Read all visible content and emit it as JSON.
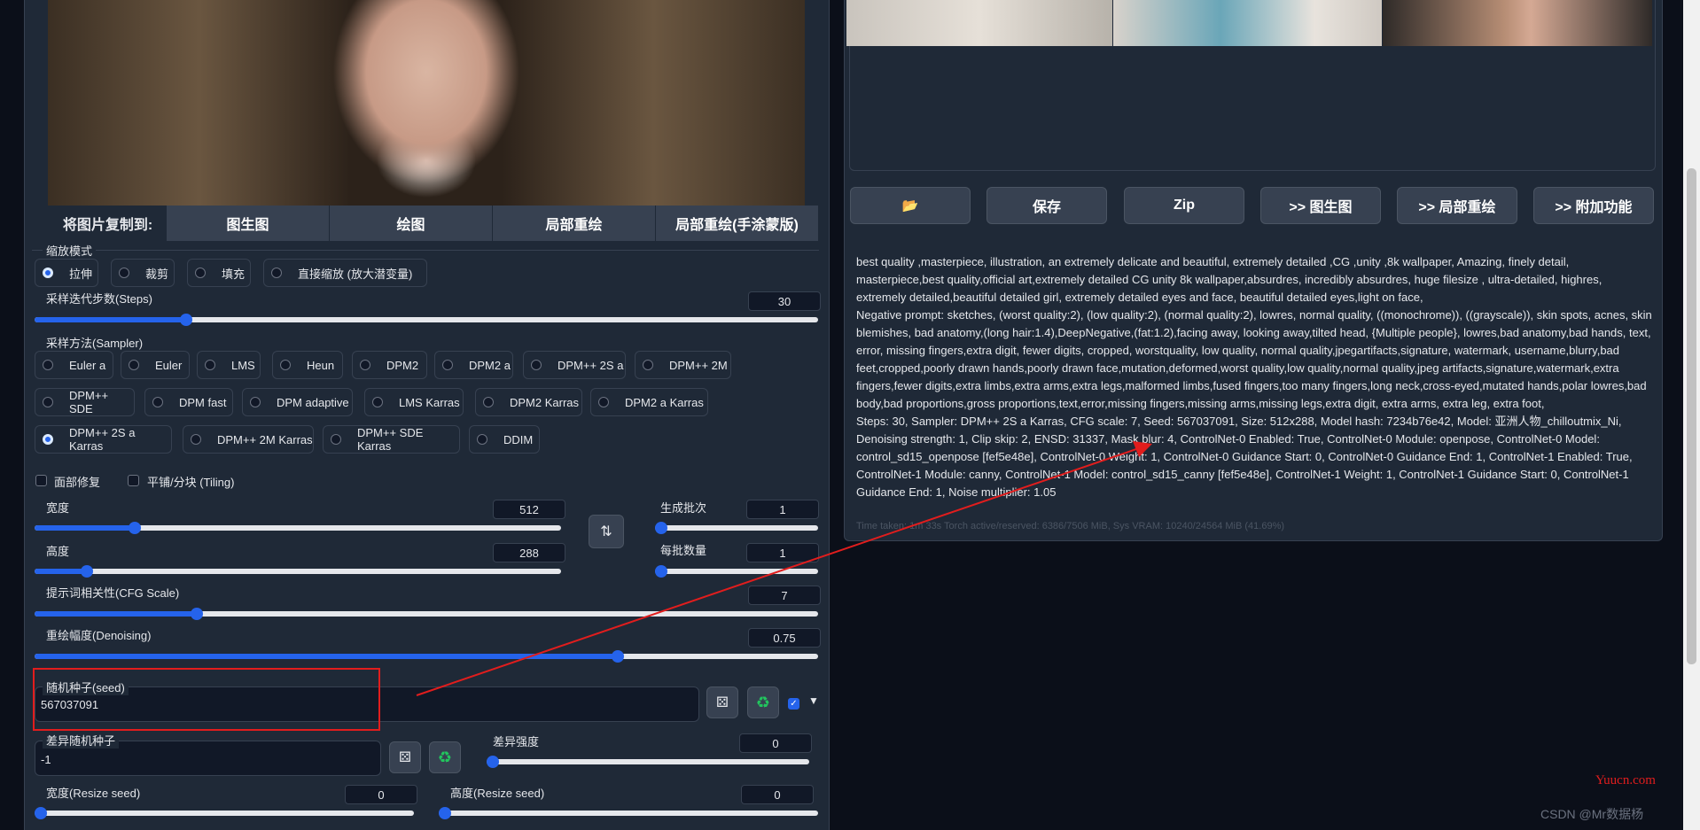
{
  "copy_to": {
    "label": "将图片复制到:",
    "buttons": [
      "图生图",
      "绘图",
      "局部重绘",
      "局部重绘(手涂蒙版)"
    ]
  },
  "resize_mode": {
    "label": "缩放模式",
    "options": [
      "拉伸",
      "裁剪",
      "填充",
      "直接缩放 (放大潜变量)"
    ],
    "selected": "拉伸"
  },
  "steps": {
    "label": "采样迭代步数(Steps)",
    "value": "30"
  },
  "sampler": {
    "label": "采样方法(Sampler)",
    "options": [
      "Euler a",
      "Euler",
      "LMS",
      "Heun",
      "DPM2",
      "DPM2 a",
      "DPM++ 2S a",
      "DPM++ 2M",
      "DPM++ SDE",
      "DPM fast",
      "DPM adaptive",
      "LMS Karras",
      "DPM2 Karras",
      "DPM2 a Karras",
      "DPM++ 2S a Karras",
      "DPM++ 2M Karras",
      "DPM++ SDE Karras",
      "DDIM"
    ],
    "selected": "DPM++ 2S a Karras"
  },
  "checkboxes": {
    "face_restore": "面部修复",
    "tiling": "平铺/分块 (Tiling)"
  },
  "width": {
    "label": "宽度",
    "value": "512"
  },
  "height": {
    "label": "高度",
    "value": "288"
  },
  "batch_count": {
    "label": "生成批次",
    "value": "1"
  },
  "batch_size": {
    "label": "每批数量",
    "value": "1"
  },
  "cfg": {
    "label": "提示词相关性(CFG Scale)",
    "value": "7"
  },
  "denoising": {
    "label": "重绘幅度(Denoising)",
    "value": "0.75"
  },
  "seed": {
    "label": "随机种子(seed)",
    "value": "567037091"
  },
  "variation_seed": {
    "label": "差异随机种子",
    "value": "-1"
  },
  "variation_strength": {
    "label": "差异强度",
    "value": "0"
  },
  "resize_seed_width": {
    "label": "宽度(Resize seed)",
    "value": "0"
  },
  "resize_seed_height": {
    "label": "高度(Resize seed)",
    "value": "0"
  },
  "actions": [
    "📂",
    "保存",
    "Zip",
    ">> 图生图",
    ">> 局部重绘",
    ">> 附加功能"
  ],
  "info": {
    "prompt": "best quality ,masterpiece, illustration, an extremely delicate and beautiful, extremely detailed ,CG ,unity ,8k wallpaper, Amazing, finely detail, masterpiece,best quality,official art,extremely detailed CG unity 8k wallpaper,absurdres, incredibly absurdres, huge filesize , ultra-detailed, highres, extremely detailed,beautiful detailed girl, extremely detailed eyes and face, beautiful detailed eyes,light on face,",
    "negative": "Negative prompt: sketches, (worst quality:2), (low quality:2), (normal quality:2), lowres, normal quality, ((monochrome)), ((grayscale)), skin spots, acnes, skin blemishes, bad anatomy,(long hair:1.4),DeepNegative,(fat:1.2),facing away, looking away,tilted head, {Multiple people}, lowres,bad anatomy,bad hands, text, error, missing fingers,extra digit, fewer digits, cropped, worstquality, low quality, normal quality,jpegartifacts,signature, watermark, username,blurry,bad feet,cropped,poorly drawn hands,poorly drawn face,mutation,deformed,worst quality,low quality,normal quality,jpeg artifacts,signature,watermark,extra fingers,fewer digits,extra limbs,extra arms,extra legs,malformed limbs,fused fingers,too many fingers,long neck,cross-eyed,mutated hands,polar lowres,bad body,bad proportions,gross proportions,text,error,missing fingers,missing arms,missing legs,extra digit, extra arms, extra leg, extra foot,",
    "params": "Steps: 30, Sampler: DPM++ 2S a Karras, CFG scale: 7, Seed: 567037091, Size: 512x288, Model hash: 7234b76e42, Model: 亚洲人物_chilloutmix_Ni, Denoising strength: 1, Clip skip: 2, ENSD: 31337, Mask blur: 4, ControlNet-0 Enabled: True, ControlNet-0 Module: openpose, ControlNet-0 Model: control_sd15_openpose [fef5e48e], ControlNet-0 Weight: 1, ControlNet-0 Guidance Start: 0, ControlNet-0 Guidance End: 1, ControlNet-1 Enabled: True, ControlNet-1 Module: canny, ControlNet-1 Model: control_sd15_canny [fef5e48e], ControlNet-1 Weight: 1, ControlNet-1 Guidance Start: 0, ControlNet-1 Guidance End: 1, Noise multiplier: 1.05",
    "time": "Time taken: 1m 33s  Torch active/reserved: 6386/7506 MiB, Sys VRAM: 10240/24564 MiB (41.69%)"
  },
  "watermarks": {
    "site": "Yuucn.com",
    "csdn": "CSDN @Mr数据杨"
  },
  "colors": {
    "accent": "#2563eb",
    "annotation": "#e11d1d",
    "panel": "#1f2937",
    "background": "#0b0f19"
  }
}
